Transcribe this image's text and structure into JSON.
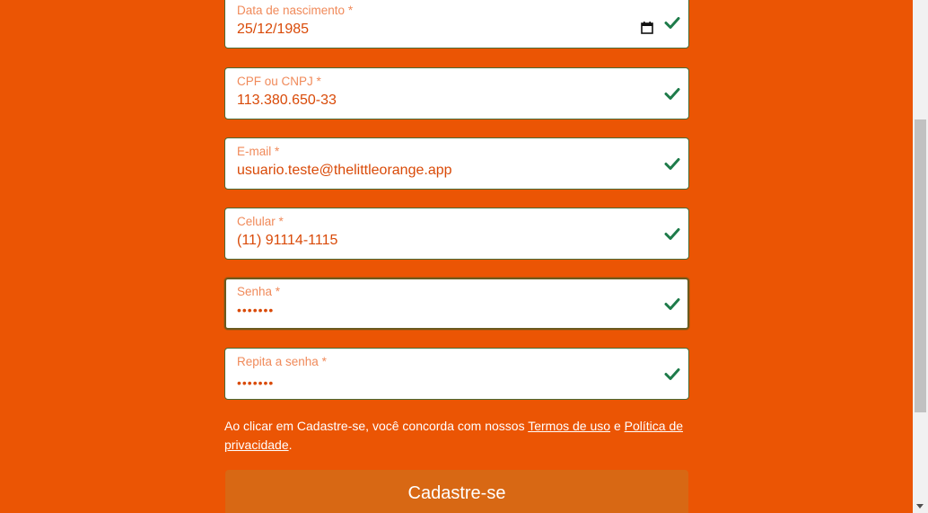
{
  "form": {
    "fields": [
      {
        "label": "Data de nascimento *",
        "value": "25/12/1985"
      },
      {
        "label": "CPF ou CNPJ *",
        "value": "113.380.650-33"
      },
      {
        "label": "E-mail *",
        "value": "usuario.teste@thelittleorange.app"
      },
      {
        "label": "Celular *",
        "value": "(11) 91114-1115"
      },
      {
        "label": "Senha *",
        "value": "•••••••"
      },
      {
        "label": "Repita a senha *",
        "value": "•••••••"
      }
    ],
    "terms": {
      "prefix": "Ao clicar em Cadastre-se, você concorda com nossos ",
      "terms_link": "Termos de uso",
      "and": " e ",
      "privacy_link": "Política de privacidade",
      "suffix": "."
    },
    "submit_label": "Cadastre-se"
  },
  "icons": {
    "field_status": "check-icon",
    "date_picker": "calendar-icon"
  },
  "colors": {
    "background": "#eb5504",
    "check": "#1e7b4a",
    "button": "#d86814",
    "field_text": "#d94a08",
    "label_text": "#f08a5a"
  }
}
